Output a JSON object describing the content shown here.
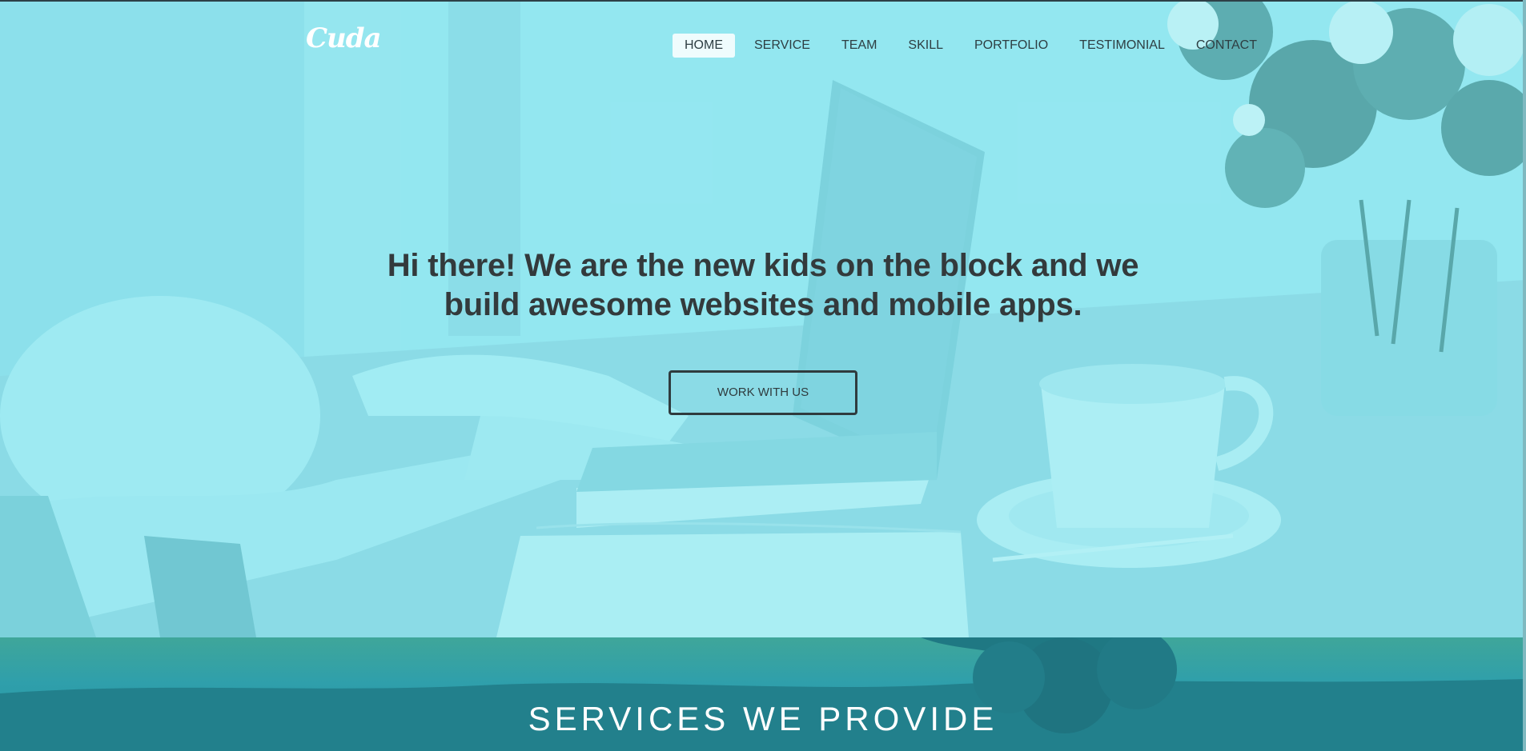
{
  "brand": {
    "logo_text": "Cuda"
  },
  "nav": {
    "items": [
      {
        "label": "HOME",
        "active": true
      },
      {
        "label": "SERVICE",
        "active": false
      },
      {
        "label": "TEAM",
        "active": false
      },
      {
        "label": "SKILL",
        "active": false
      },
      {
        "label": "PORTFOLIO",
        "active": false
      },
      {
        "label": "TESTIMONIAL",
        "active": false
      },
      {
        "label": "CONTACT",
        "active": false
      }
    ]
  },
  "hero": {
    "title_line1": "Hi there! We are the new kids on the block and we",
    "title_line2": "build awesome websites and mobile apps.",
    "cta_label": "WORK WITH US"
  },
  "services": {
    "title": "SERVICES WE PROVIDE"
  },
  "colors": {
    "hero_tint": "#8fe3ee",
    "services_bg": "#2a9eab",
    "text_dark": "#333a3c"
  }
}
